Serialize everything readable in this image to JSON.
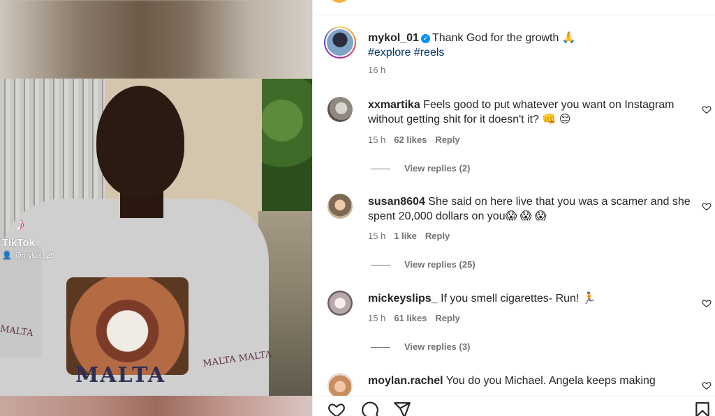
{
  "media": {
    "tiktok_brand": "TikTok",
    "tiktok_handle": "@mykol_26",
    "shirt_text_main": "MALTA",
    "shirt_text_left": "MALTA",
    "shirt_text_right": "MALTA MALTA"
  },
  "post": {
    "username": "mykol_01",
    "verified": true,
    "caption": "Thank God for the growth 🙏",
    "hashtags": "#explore #reels",
    "time": "16 h"
  },
  "comments": [
    {
      "username": "xxmartika",
      "text": "Feels good to put whatever you want on Instagram without getting shit for it doesn't it? 👊 😔",
      "time": "15 h",
      "likes": "62 likes",
      "reply": "Reply",
      "view_replies": "View replies (2)"
    },
    {
      "username": "susan8604",
      "text": "She said on here live that you was a scamer and she spent 20,000 dollars on you😱 😱 😱",
      "time": "15 h",
      "likes": "1 like",
      "reply": "Reply",
      "view_replies": "View replies (25)"
    },
    {
      "username": "mickeyslips_",
      "text": "If you smell cigarettes- Run! 🏃",
      "time": "15 h",
      "likes": "61 likes",
      "reply": "Reply",
      "view_replies": "View replies (3)"
    },
    {
      "username": "moylan.rachel",
      "text": "You do you Michael. Angela keeps making",
      "time": "",
      "likes": "",
      "reply": "",
      "view_replies": ""
    }
  ],
  "icons": {
    "like": "heart-icon",
    "comment": "comment-icon",
    "share": "share-icon",
    "save": "bookmark-icon"
  },
  "colors": {
    "verified": "#0095f6",
    "hashtag": "#00376b",
    "muted": "#737373"
  }
}
